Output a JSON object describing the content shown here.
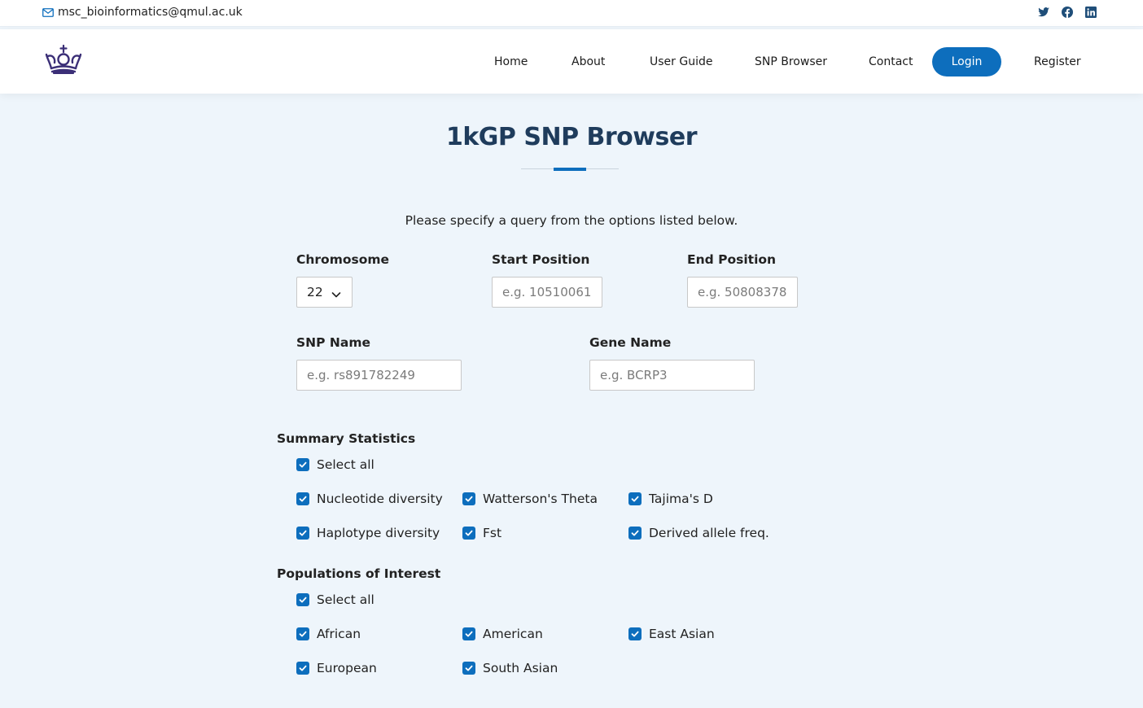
{
  "topbar": {
    "email": "msc_bioinformatics@qmul.ac.uk",
    "socials": [
      "twitter-icon",
      "facebook-icon",
      "linkedin-icon"
    ]
  },
  "nav": {
    "items": [
      "Home",
      "About",
      "User Guide",
      "SNP Browser",
      "Contact"
    ],
    "login": "Login",
    "register": "Register"
  },
  "page": {
    "title": "1kGP SNP Browser",
    "intro": "Please specify a query from the options listed below."
  },
  "query": {
    "chromosome": {
      "label": "Chromosome",
      "value": "22"
    },
    "start": {
      "label": "Start Position",
      "placeholder": "e.g. 10510061"
    },
    "end": {
      "label": "End Position",
      "placeholder": "e.g. 50808378"
    },
    "snp": {
      "label": "SNP Name",
      "placeholder": "e.g. rs891782249"
    },
    "gene": {
      "label": "Gene Name",
      "placeholder": "e.g. BCRP3"
    }
  },
  "summary": {
    "heading": "Summary Statistics",
    "select_all": "Select all",
    "options": [
      "Nucleotide diversity",
      "Watterson's Theta",
      "Tajima's D",
      "Haplotype diversity",
      "Fst",
      "Derived allele freq."
    ]
  },
  "populations": {
    "heading": "Populations of Interest",
    "select_all": "Select all",
    "options": [
      "African",
      "American",
      "East Asian",
      "European",
      "South Asian"
    ]
  },
  "colors": {
    "accent": "#0d6ebd",
    "title": "#1f3c5c",
    "background": "#eef5fb",
    "logo": "#3b2f77"
  }
}
